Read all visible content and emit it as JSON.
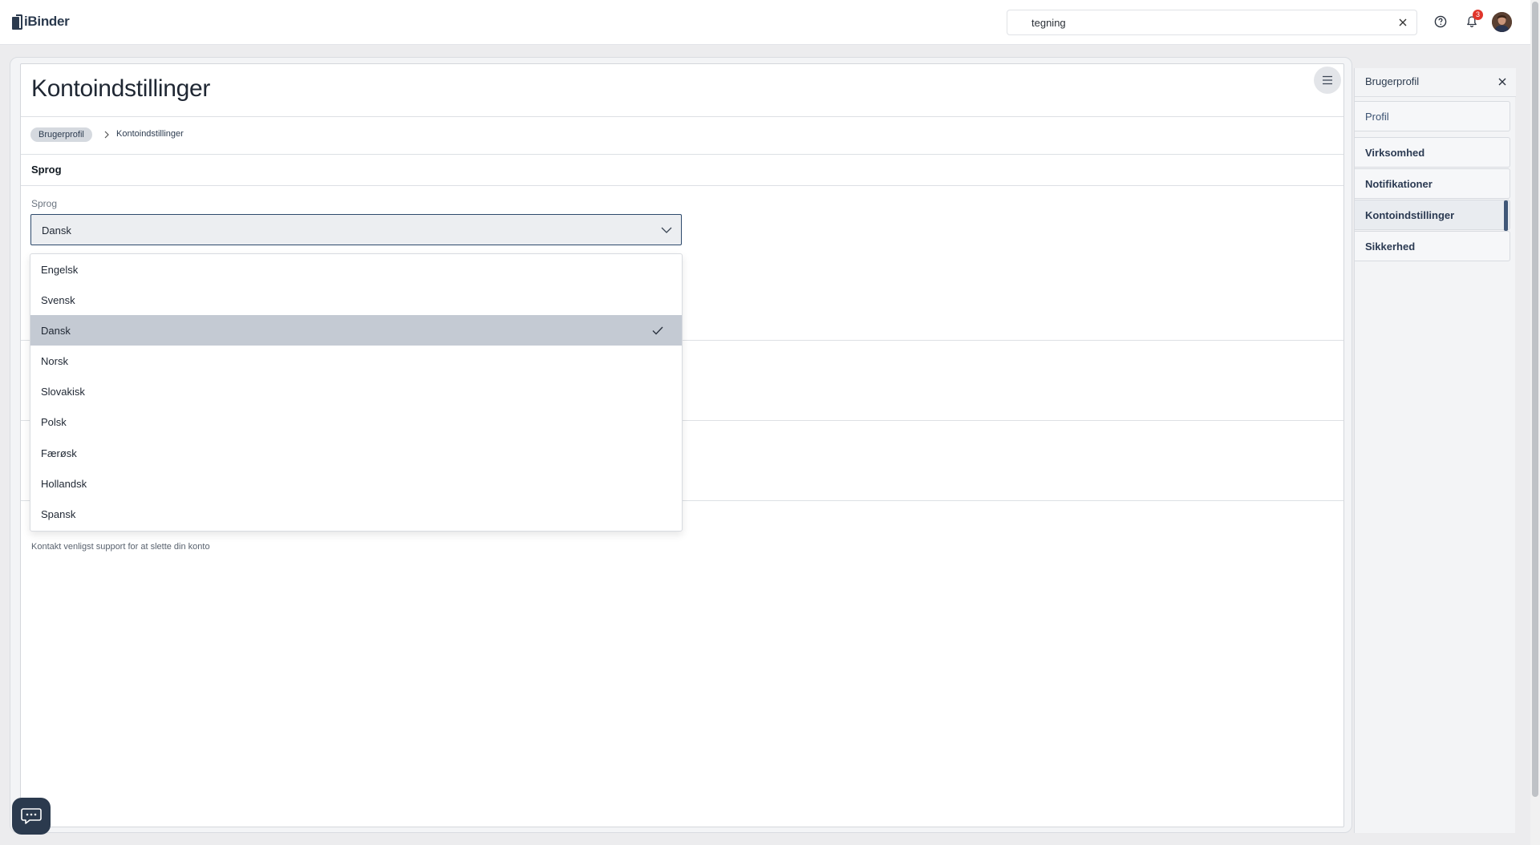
{
  "app": {
    "logo_text": "iBinder"
  },
  "topbar": {
    "search_value": "tegning",
    "notification_count": "3"
  },
  "page": {
    "title": "Kontoindstillinger",
    "breadcrumb": [
      "Brugerprofil",
      "Kontoindstillinger"
    ],
    "section_title": "Sprog",
    "field_label": "Sprog",
    "selected_language": "Dansk",
    "delete_note": "Kontakt venligst support for at slette din konto"
  },
  "dropdown": {
    "options": [
      "Engelsk",
      "Svensk",
      "Dansk",
      "Norsk",
      "Slovakisk",
      "Polsk",
      "Færøsk",
      "Hollandsk",
      "Spansk"
    ],
    "selected_index": 2
  },
  "side_panel": {
    "title": "Brugerprofil",
    "items": [
      {
        "label": "Profil",
        "active": false,
        "bold": false
      },
      {
        "label": "Virksomhed",
        "active": false,
        "bold": true
      },
      {
        "label": "Notifikationer",
        "active": false,
        "bold": true
      },
      {
        "label": "Kontoindstillinger",
        "active": true,
        "bold": true
      },
      {
        "label": "Sikkerhed",
        "active": false,
        "bold": true
      }
    ]
  },
  "colors": {
    "brand": "#2b3a4e",
    "accent": "#3f5777",
    "badge": "#e0352b",
    "selected_option": "#c4cad3"
  }
}
